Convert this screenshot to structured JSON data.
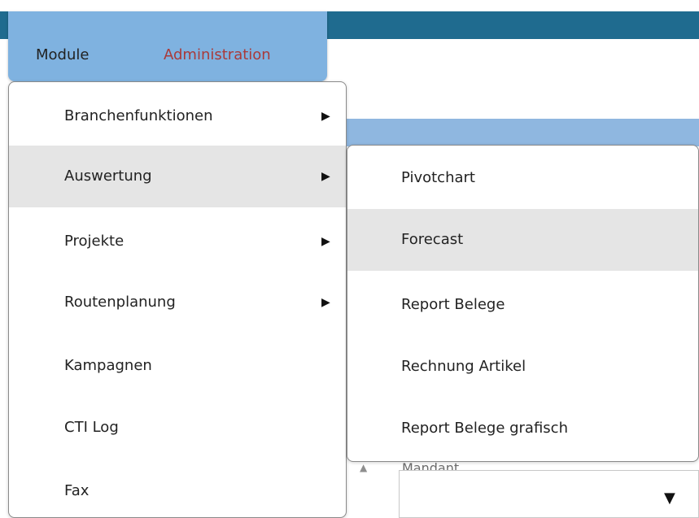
{
  "menu_bar": {
    "items": [
      {
        "label": "Module"
      },
      {
        "label": "Administration"
      }
    ]
  },
  "menus": {
    "primary": [
      {
        "label": "Branchenfunktionen",
        "has_submenu": true
      },
      {
        "label": "Auswertung",
        "has_submenu": true,
        "active": true
      },
      {
        "label": "Projekte",
        "has_submenu": true
      },
      {
        "label": "Routenplanung",
        "has_submenu": true
      },
      {
        "label": "Kampagnen",
        "has_submenu": false
      },
      {
        "label": "CTI Log",
        "has_submenu": false
      },
      {
        "label": "Fax",
        "has_submenu": false
      }
    ],
    "submenu_auswertung": [
      {
        "label": "Pivotchart"
      },
      {
        "label": "Forecast",
        "active": true
      },
      {
        "label": "Report Belege"
      },
      {
        "label": "Rechnung Artikel"
      },
      {
        "label": "Report Belege grafisch"
      }
    ]
  },
  "background_field": {
    "label": "Mandant"
  },
  "icons": {
    "submenu_arrow": "triangle-right",
    "dropdown_arrow": "triangle-down",
    "scroll_arrow": "triangle-up"
  }
}
